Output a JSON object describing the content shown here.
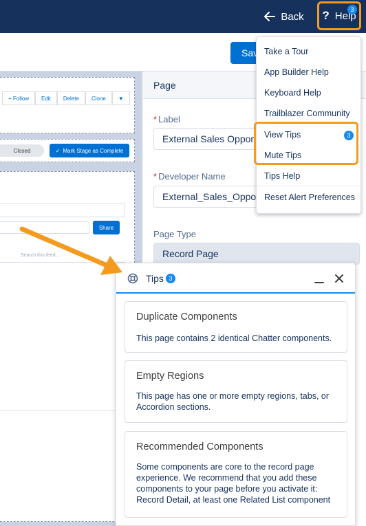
{
  "topbar": {
    "back_label": "Back",
    "help_label": "Help",
    "help_badge": "3"
  },
  "toolbar": {
    "save_label": "Save"
  },
  "canvas": {
    "header_buttons": [
      "+ Follow",
      "Edit",
      "Delete",
      "Clone"
    ],
    "path_closed_label": "Closed",
    "mark_stage_label": "Mark Stage as Complete",
    "share_label": "Share",
    "search_feed_placeholder": "Search this feed..."
  },
  "properties": {
    "title": "Page",
    "label_field": {
      "label": "Label",
      "value": "External Sales Opportunity"
    },
    "developer_name_field": {
      "label": "Developer Name",
      "value": "External_Sales_Opportunity"
    },
    "page_type_field": {
      "label": "Page Type",
      "value": "Record Page"
    }
  },
  "help_menu": {
    "items": [
      "Take a Tour",
      "App Builder Help",
      "Keyboard Help",
      "Trailblazer Community",
      "View Tips",
      "Mute Tips",
      "Tips Help",
      "Reset Alert Preferences"
    ],
    "view_tips_badge": "3"
  },
  "tips_panel": {
    "title": "Tips",
    "badge": "3",
    "cards": [
      {
        "title": "Duplicate Components",
        "body": "This page contains 2 identical Chatter components."
      },
      {
        "title": "Empty Regions",
        "body": "This page has one or more empty regions, tabs, or Accordion sections."
      },
      {
        "title": "Recommended Components",
        "body": "Some components are core to the record page experience. We recommend that you add these components to your page before you activate it: Record Detail, at least one Related List component"
      }
    ]
  },
  "colors": {
    "nav_bg": "#16325c",
    "brand_blue": "#0070d2",
    "badge_blue": "#1589ee",
    "highlight_orange": "#f49a1f"
  }
}
